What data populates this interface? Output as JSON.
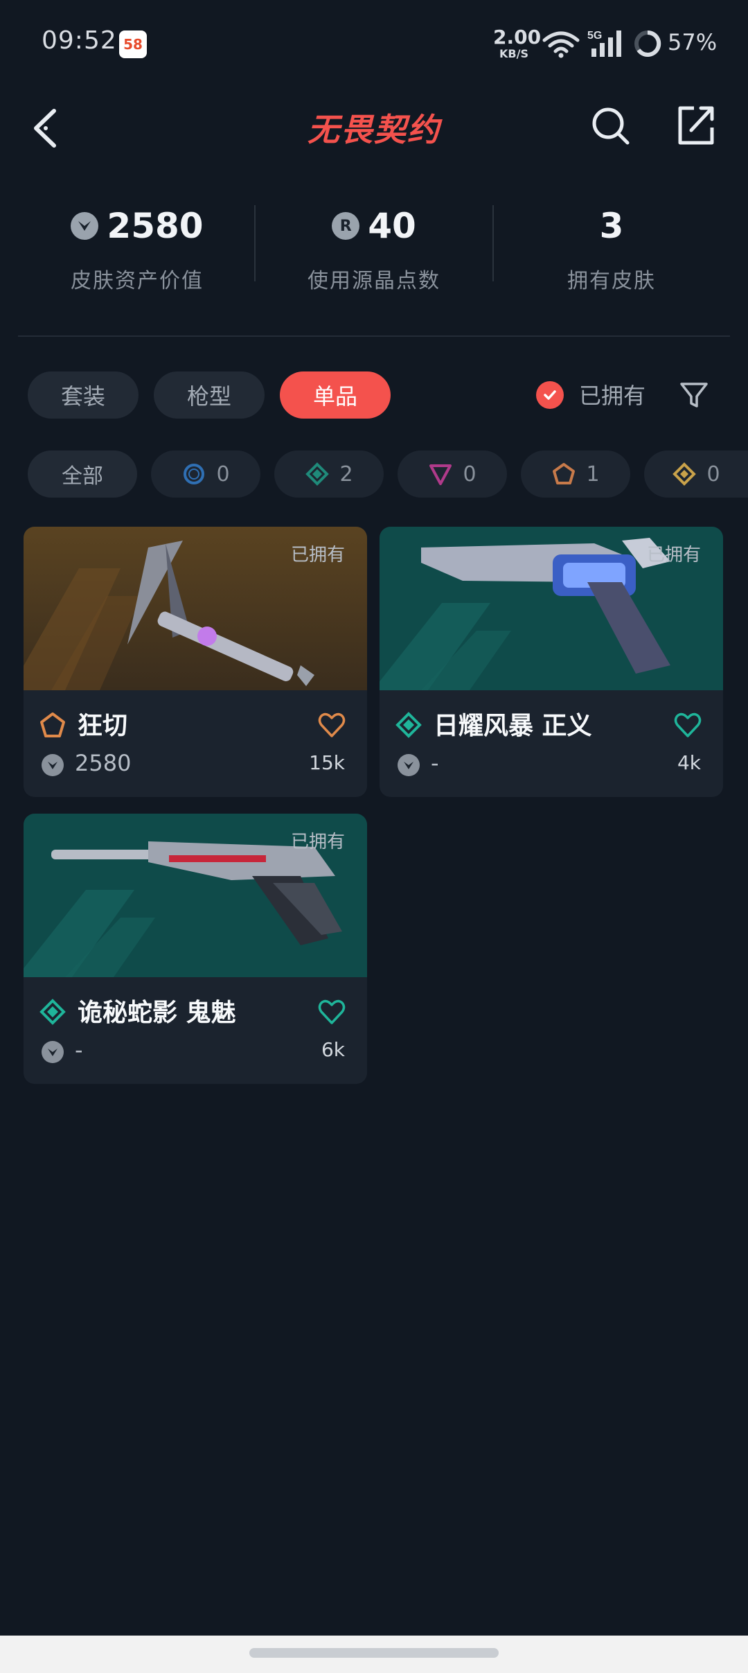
{
  "status_bar": {
    "time": "09:52",
    "app_badge": "58",
    "net_speed_value": "2.00",
    "net_speed_unit": "KB/S",
    "signal_label": "5G",
    "battery": "57%"
  },
  "header": {
    "title": "无畏契约",
    "brand_color": "#f4524d"
  },
  "stats": [
    {
      "value": "2580",
      "label": "皮肤资产价值",
      "icon": "vp-coin-icon"
    },
    {
      "value": "40",
      "label": "使用源晶点数",
      "icon": "radianite-icon"
    },
    {
      "value": "3",
      "label": "拥有皮肤",
      "icon": ""
    }
  ],
  "tabs": [
    {
      "label": "套装",
      "active": false
    },
    {
      "label": "枪型",
      "active": false
    },
    {
      "label": "单品",
      "active": true
    }
  ],
  "owned_filter": {
    "label": "已拥有",
    "checked": true
  },
  "rarity_chips": [
    {
      "label": "全部",
      "count": ""
    },
    {
      "icon": "select-tier-icon",
      "color": "#2f6fb3",
      "count": "0"
    },
    {
      "icon": "deluxe-tier-icon",
      "color": "#1f8a7a",
      "count": "2"
    },
    {
      "icon": "premium-tier-icon",
      "color": "#b03a8a",
      "count": "0"
    },
    {
      "icon": "exclusive-tier-icon",
      "color": "#c77a4a",
      "count": "1"
    },
    {
      "icon": "ultra-tier-icon",
      "color": "#c9a24a",
      "count": "0"
    }
  ],
  "cards": [
    {
      "name": "狂切",
      "owned_tag": "已拥有",
      "price": "2580",
      "likes": "15k",
      "tier_color": "#e08a4a",
      "bg": "orange"
    },
    {
      "name": "日耀风暴 正义",
      "owned_tag": "已拥有",
      "price": "-",
      "likes": "4k",
      "tier_color": "#1fb59a",
      "bg": "teal"
    },
    {
      "name": "诡秘蛇影 鬼魅",
      "owned_tag": "已拥有",
      "price": "-",
      "likes": "6k",
      "tier_color": "#1fb59a",
      "bg": "teal"
    }
  ]
}
